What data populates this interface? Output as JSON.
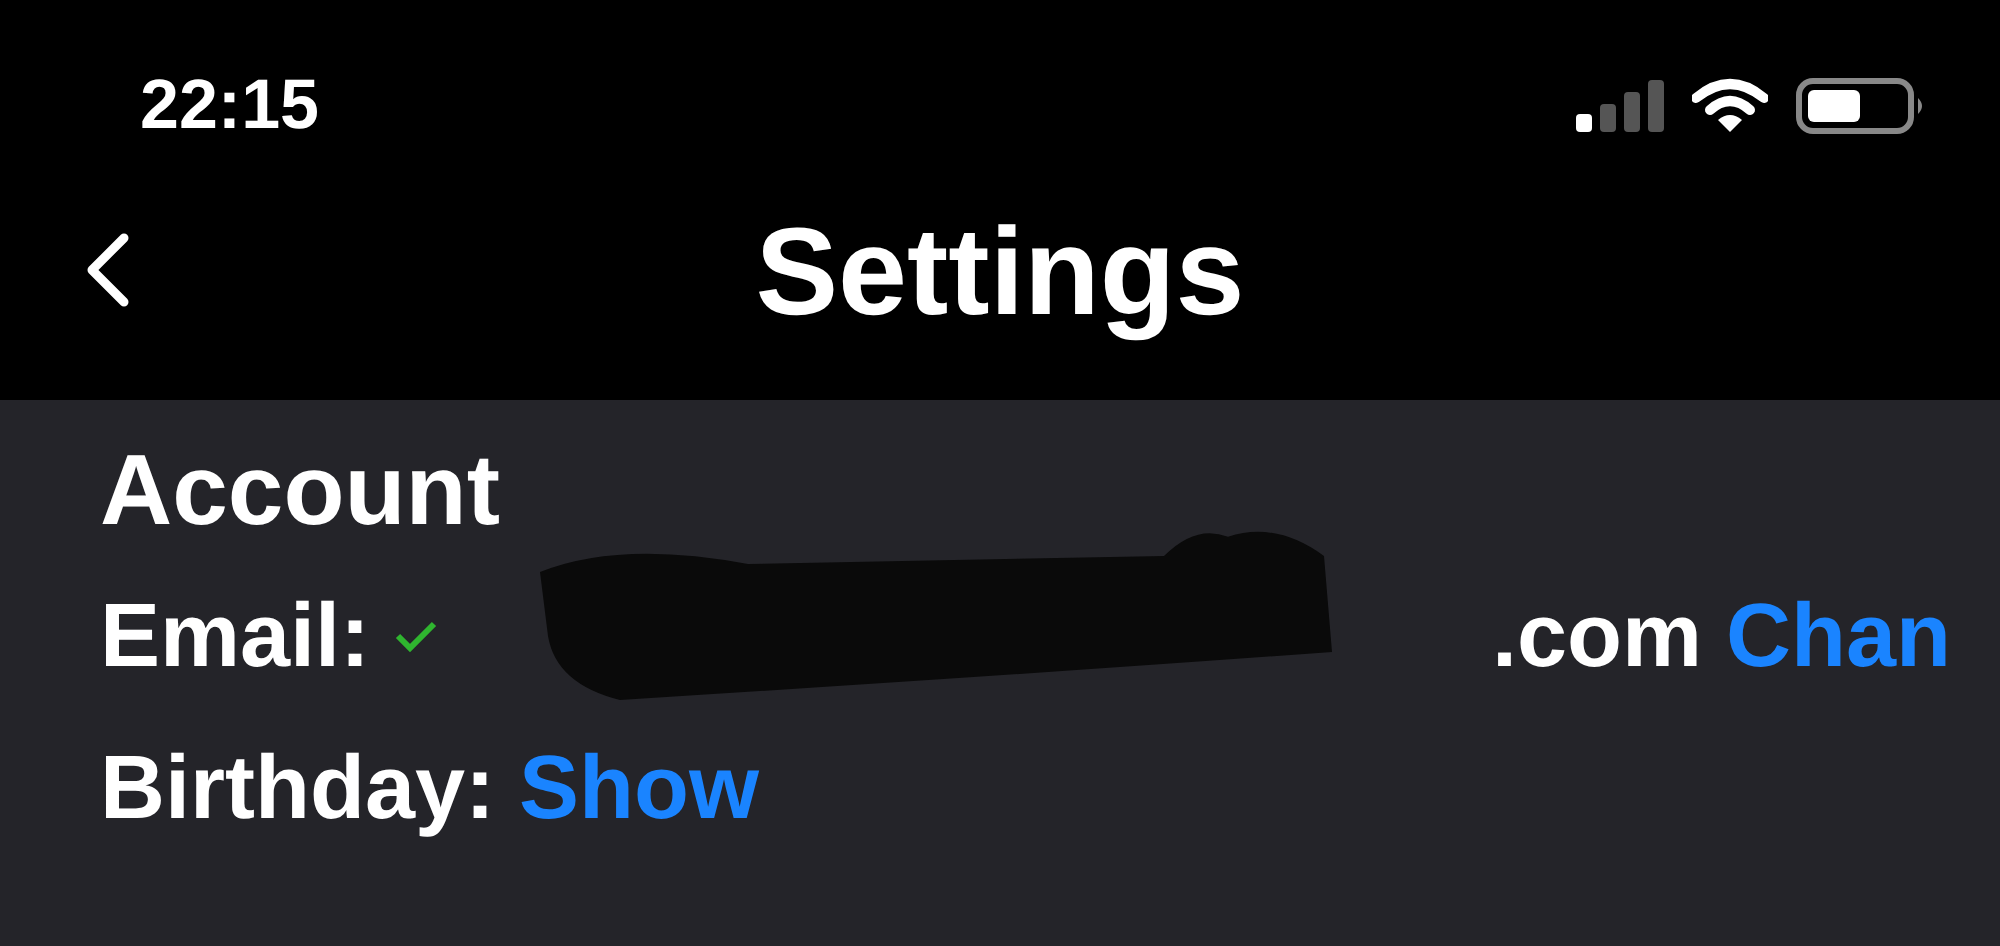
{
  "status_bar": {
    "time": "22:15"
  },
  "nav": {
    "title": "Settings"
  },
  "section": {
    "title": "Account"
  },
  "rows": [
    {
      "kind": "email",
      "label": "Email:",
      "verified": true,
      "value": ".com",
      "redacted": true,
      "action": "Chan"
    },
    {
      "kind": "birthday",
      "label": "Birthday:",
      "action": "Show"
    }
  ]
}
